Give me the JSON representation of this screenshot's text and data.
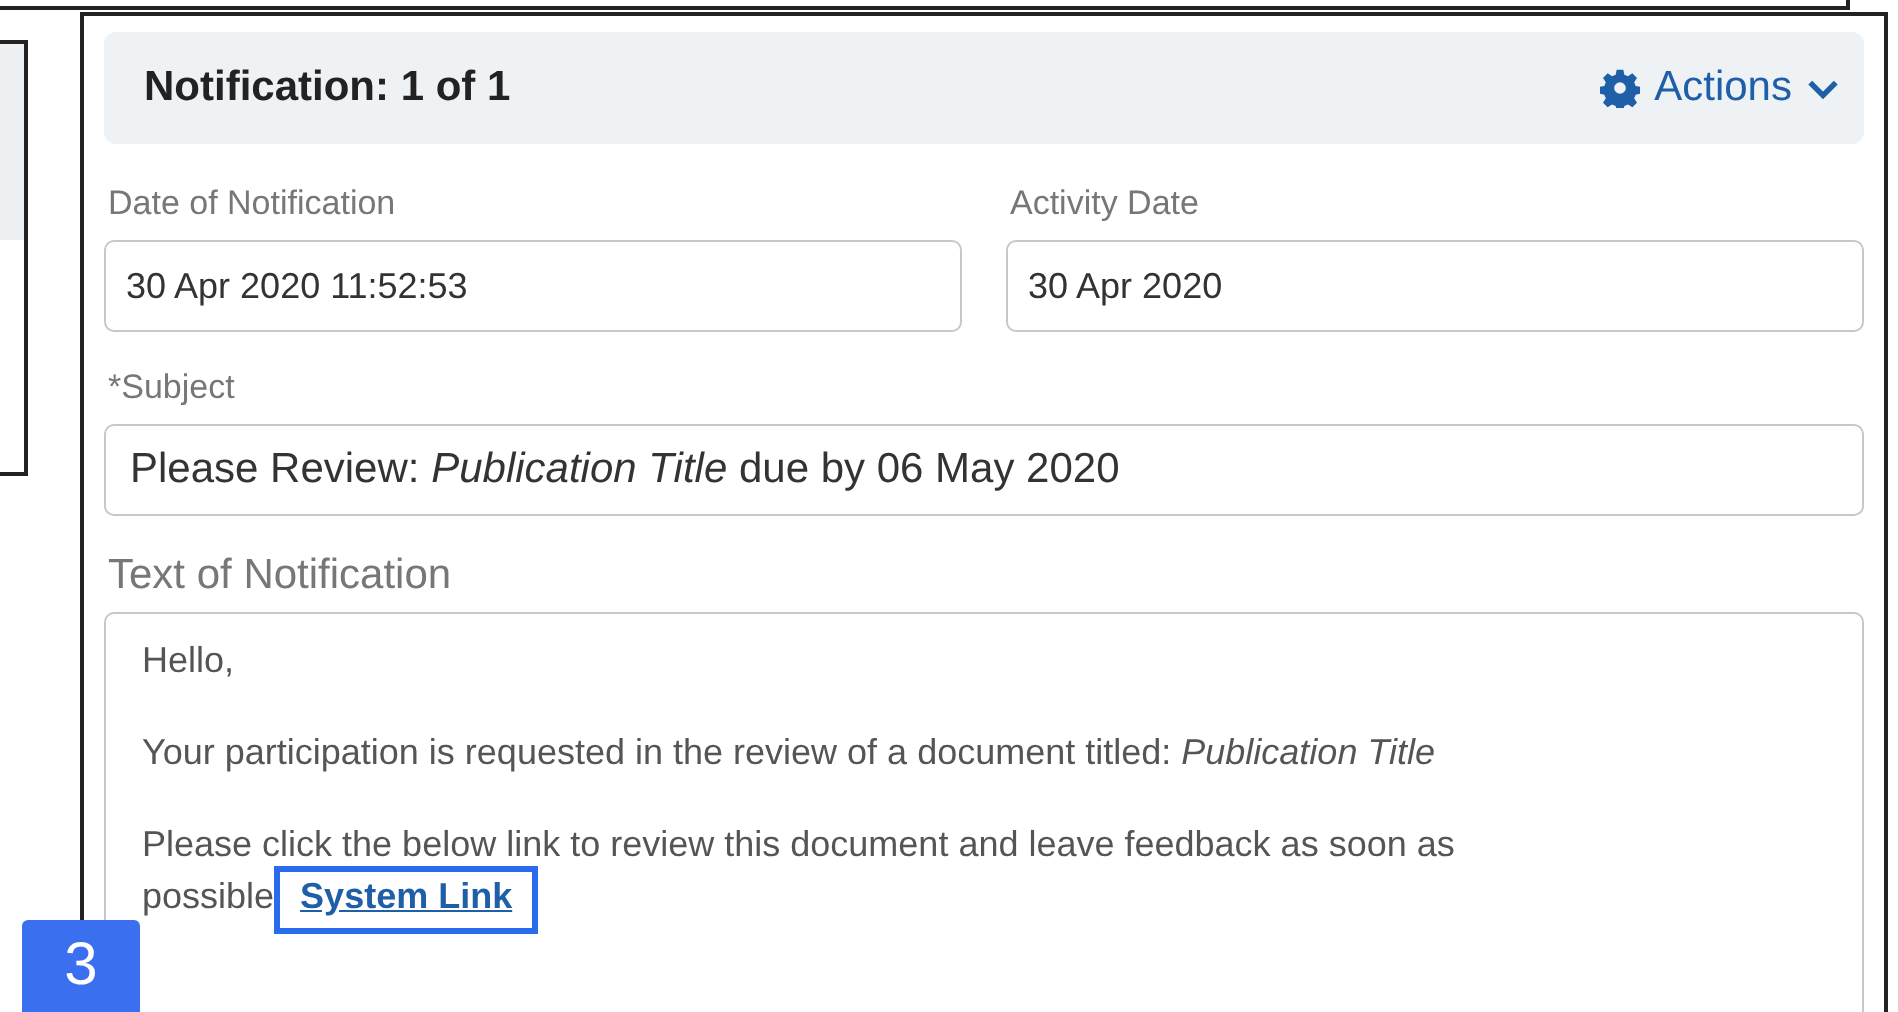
{
  "notification": {
    "title": "Notification: 1 of 1",
    "actions": "Actions"
  },
  "fields": [
    {
      "label": "Date of Notification",
      "value": "30 Apr 2020 11:52:53"
    },
    {
      "label": "Activity Date",
      "value": "30 Apr 2020"
    }
  ],
  "subject": {
    "label": "*Subject",
    "value": "Please Review: *Publication Title* due by 06 May 2020"
  },
  "text_of_notification": {
    "label": "Text of Notification",
    "paragraphs": [
      {
        "text": "Hello,"
      },
      {
        "text": "Your participation is requested in the review of a document titled: *Publication Title*"
      },
      {
        "text": "Please click the below link to review this document and leave feedback as soon as possible",
        "link": "System Link"
      }
    ]
  },
  "callout": "3"
}
